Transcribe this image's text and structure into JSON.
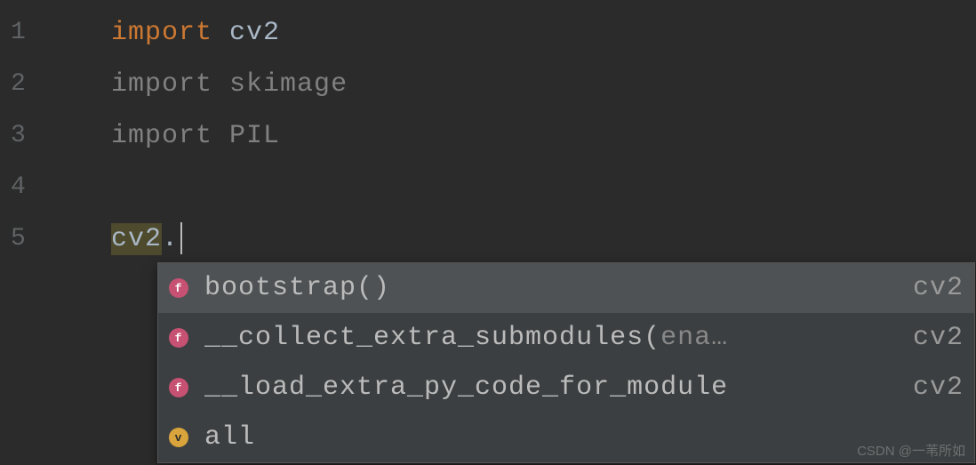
{
  "lines": [
    {
      "num": "1",
      "keyword": "import",
      "module": "cv2",
      "active": true
    },
    {
      "num": "2",
      "keyword": "import",
      "module": "skimage",
      "active": false
    },
    {
      "num": "3",
      "keyword": "import",
      "module": "PIL",
      "active": false
    },
    {
      "num": "4",
      "keyword": "",
      "module": "",
      "active": false
    },
    {
      "num": "5",
      "keyword": "",
      "module": "",
      "active": false
    }
  ],
  "current_line": {
    "object": "cv2",
    "dot": "."
  },
  "autocomplete": {
    "items": [
      {
        "icon": "f",
        "name": "bootstrap",
        "paren": "()",
        "param": "",
        "module": "cv2",
        "selected": true
      },
      {
        "icon": "f",
        "name": "__collect_extra_submodules",
        "paren": "(",
        "param": "ena…",
        "module": "cv2",
        "selected": false
      },
      {
        "icon": "f",
        "name": "__load_extra_py_code_for_module",
        "paren": "",
        "param": "",
        "module": "cv2",
        "selected": false
      },
      {
        "icon": "v",
        "name": "all",
        "paren": "",
        "param": "",
        "module": "",
        "selected": false
      }
    ]
  },
  "watermark": "CSDN @一苇所如"
}
